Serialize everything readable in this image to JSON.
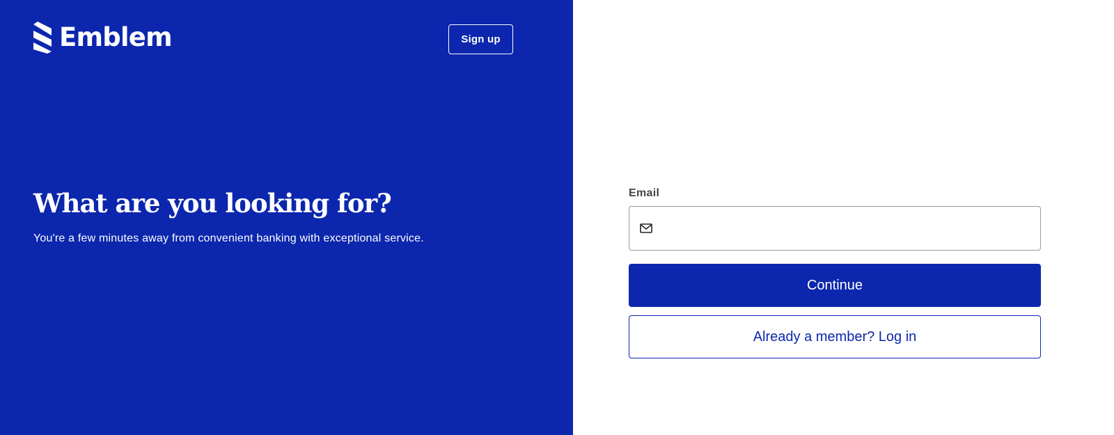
{
  "brand": {
    "name": "Emblem",
    "logo_icon": "emblem-stripes-icon"
  },
  "header": {
    "signup_label": "Sign up"
  },
  "hero": {
    "title": "What are you looking for?",
    "subtitle": "You're a few minutes away from convenient banking with exceptional service."
  },
  "form": {
    "email_label": "Email",
    "email_value": "",
    "email_icon": "mail-icon",
    "continue_label": "Continue",
    "login_label": "Already a member? Log in"
  },
  "colors": {
    "brand_blue": "#0c27ad",
    "background": "#ffffff",
    "label_gray": "#444444",
    "field_border": "#9a9a9a"
  }
}
